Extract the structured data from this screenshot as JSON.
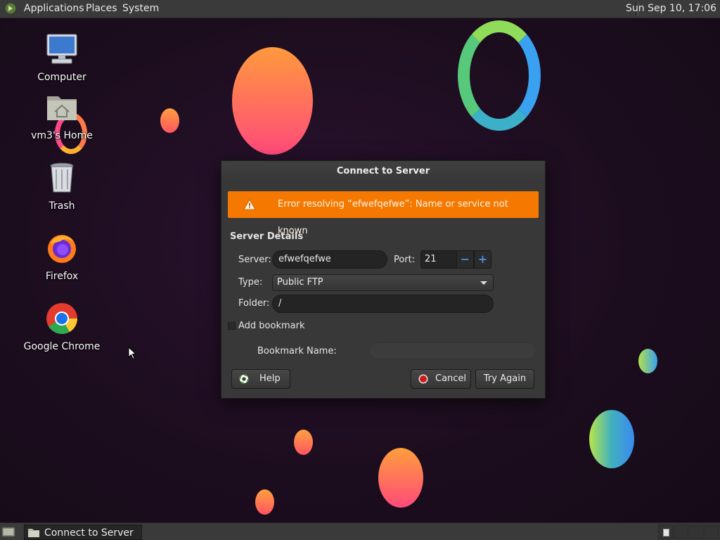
{
  "top_panel": {
    "menu": {
      "applications": "Applications",
      "places": "Places",
      "system": "System"
    },
    "clock": "Sun Sep 10, 17:06"
  },
  "desktop": {
    "icons": [
      {
        "label": "Computer",
        "icon": "computer-icon"
      },
      {
        "label": "vm3's Home",
        "icon": "home-folder-icon"
      },
      {
        "label": "Trash",
        "icon": "trash-icon"
      },
      {
        "label": "Firefox",
        "icon": "firefox-icon"
      },
      {
        "label": "Google Chrome",
        "icon": "chrome-icon"
      }
    ]
  },
  "dialog": {
    "title": "Connect to Server",
    "error": "Error resolving “efwefqefwe”: Name or service not known",
    "section_title": "Server Details",
    "server_label": "Server:",
    "server_value": "efwefqefwe",
    "port_label": "Port:",
    "port_value": "21",
    "port_minus": "−",
    "port_plus": "+",
    "type_label": "Type:",
    "type_value": "Public FTP",
    "folder_label": "Folder:",
    "folder_value": "/",
    "add_bookmark_label": "Add bookmark",
    "add_bookmark_checked": false,
    "bookmark_name_label": "Bookmark Name:",
    "bookmark_name_value": "",
    "buttons": {
      "help": "Help",
      "cancel": "Cancel",
      "try_again": "Try Again"
    }
  },
  "bottom_panel": {
    "task_label": "Connect to Server"
  },
  "colors": {
    "error_bar": "#f57900",
    "panel": "#3a3a3a",
    "dialog": "#383838",
    "spin_accent": "#4a90d9"
  }
}
